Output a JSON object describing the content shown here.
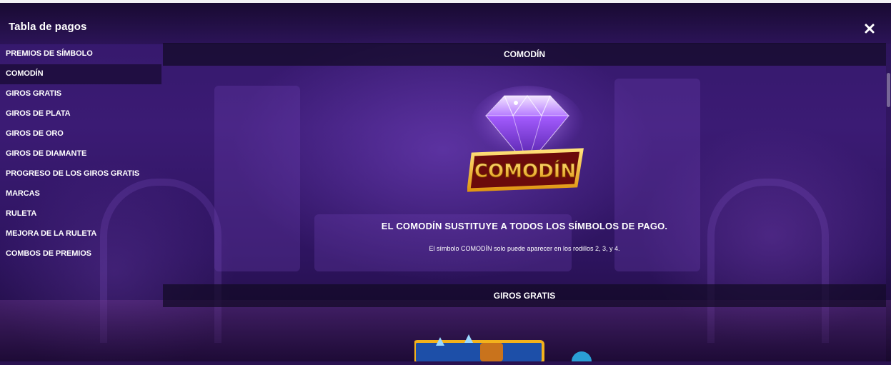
{
  "header": {
    "title": "Tabla de pagos"
  },
  "sidebar": {
    "items": [
      {
        "label": "PREMIOS DE SÍMBOLO",
        "active": false
      },
      {
        "label": "COMODÍN",
        "active": true
      },
      {
        "label": "GIROS GRATIS",
        "active": false
      },
      {
        "label": "GIROS DE PLATA",
        "active": false
      },
      {
        "label": "GIROS DE ORO",
        "active": false
      },
      {
        "label": "GIROS DE DIAMANTE",
        "active": false
      },
      {
        "label": "PROGRESO DE LOS GIROS GRATIS",
        "active": false
      },
      {
        "label": "MARCAS",
        "active": false
      },
      {
        "label": "RULETA",
        "active": false
      },
      {
        "label": "MEJORA DE LA RULETA",
        "active": false
      },
      {
        "label": "COMBOS DE PREMIOS",
        "active": false
      }
    ]
  },
  "main": {
    "sections": [
      {
        "title": "COMODÍN",
        "symbol_icon": "diamond-wild-icon",
        "symbol_text": "COMODÍN",
        "headline": "EL COMODÍN SUSTITUYE A TODOS LOS SÍMBOLOS DE PAGO.",
        "description": "El símbolo COMODÍN solo puede aparecer en los rodillos 2, 3, y 4."
      },
      {
        "title": "GIROS GRATIS",
        "symbol_icon": "free-spins-scatter-icon"
      }
    ]
  },
  "colors": {
    "background": "#2a1250",
    "section_bar": "#120a26",
    "wild_gold": "#f3b21c",
    "wild_red": "#8e1212",
    "diamond": "#b86cff"
  }
}
